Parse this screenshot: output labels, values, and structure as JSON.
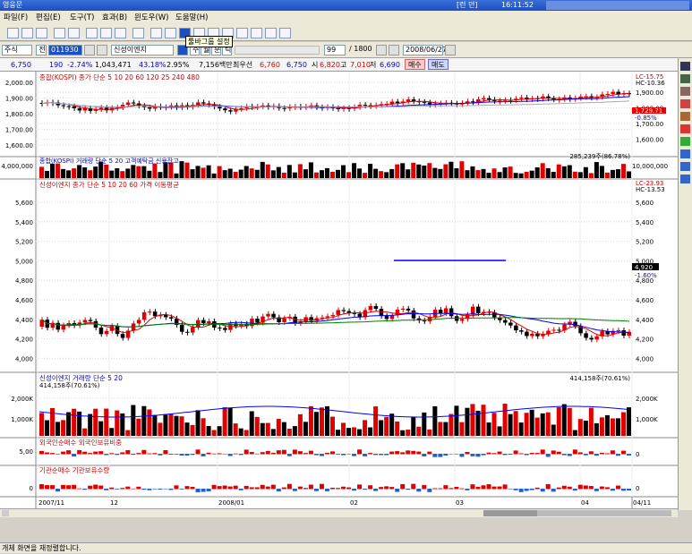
{
  "window": {
    "title": "영웅문",
    "clock_label": "[런 던]",
    "clock_time": "16:11:52"
  },
  "menu": [
    "파일(F)",
    "편집(E)",
    "도구(T)",
    "효과(B)",
    "윈도우(W)",
    "도움말(H)"
  ],
  "tooltip": "툴바그룹 설정",
  "controls": {
    "market": "주식",
    "code": "011930",
    "name": "신성이엔지",
    "period_buttons": [
      "주",
      "월",
      "분",
      "틱"
    ],
    "count": "99",
    "total": "/ 1800",
    "date": "2008/06/27"
  },
  "quote": {
    "price": "6,750",
    "change": "190",
    "change_pct": "-2.74%",
    "volume": "1,043,471",
    "vol_ratio": "43.18%",
    "turnover": "2.95%",
    "amount": "7,156백만",
    "low_label": "최우선",
    "bid1": "6,760",
    "bid2": "6,750",
    "open_label": "시",
    "open": "6,820",
    "high_label": "고",
    "high": "7,010",
    "low2_label": "저",
    "low": "6,690",
    "buy": "매수",
    "sell": "매도"
  },
  "panes": {
    "kospi": {
      "legend": [
        "종합(KOSPI)",
        "종가 단순 5",
        "10",
        "20",
        "60",
        "120",
        "25",
        "240",
        "480"
      ],
      "ticks": [
        "2,000.00",
        "1,900.00",
        "1,800.00",
        "1,700.00",
        "1,600.00"
      ],
      "right_ticks": [
        "1,900.00",
        "1,800.00",
        "1,700.00",
        "1,600.00"
      ],
      "lc": "LC-15.75",
      "hc": "HC-10.36",
      "tag_top": "1,729.71",
      "tag_bot": "-0.85%"
    },
    "kvol": {
      "legend": [
        "종합(KOSPI) 거래량",
        "단순 5",
        "20",
        "고객예탁금",
        "신용잔고"
      ],
      "left_tick": "4,000,000",
      "right_tick": "10,000,000",
      "right_label": "285,239주(86.78%)"
    },
    "price": {
      "legend": [
        "신성이엔지",
        "종가 단순 5",
        "10",
        "20",
        "60",
        "가격 이동평균"
      ],
      "lc": "LC-23.93",
      "hc": "HC-13.53",
      "ticks": [
        "5,600",
        "5,400",
        "5,200",
        "5,000",
        "4,800",
        "4,600",
        "4,400",
        "4,200",
        "4,000"
      ],
      "right_ticks": [
        "5,600",
        "5,400",
        "5,200",
        "5,000",
        "4,800",
        "4,600",
        "4,400",
        "4,200",
        "4,000"
      ],
      "tag_top": "4,920",
      "tag_bot": "-1.60%"
    },
    "vol": {
      "legend": [
        "신성이엔지 거래량",
        "단순 5",
        "20"
      ],
      "sub": "414,158주(70.61%)",
      "ticks": [
        "2,000K",
        "1,000K"
      ],
      "right_label": "414,158주(70.61%)"
    },
    "foreign": {
      "legend": [
        "외국인순매수",
        "외국인보유비중"
      ],
      "tick": "5,00",
      "right": "0"
    },
    "inst": {
      "legend": [
        "기관순매수",
        "기관보유수량"
      ],
      "tick": "0",
      "right": "0"
    }
  },
  "xaxis": [
    "2007/11",
    "12",
    "2008/01",
    "02",
    "03",
    "04",
    "04/11"
  ],
  "status": "개체 화면을 재정렬합니다.",
  "colors": {
    "up": "#e00000",
    "down": "#000000",
    "ma5": "#e00000",
    "ma20": "#0000ff",
    "ma60": "#008000"
  }
}
